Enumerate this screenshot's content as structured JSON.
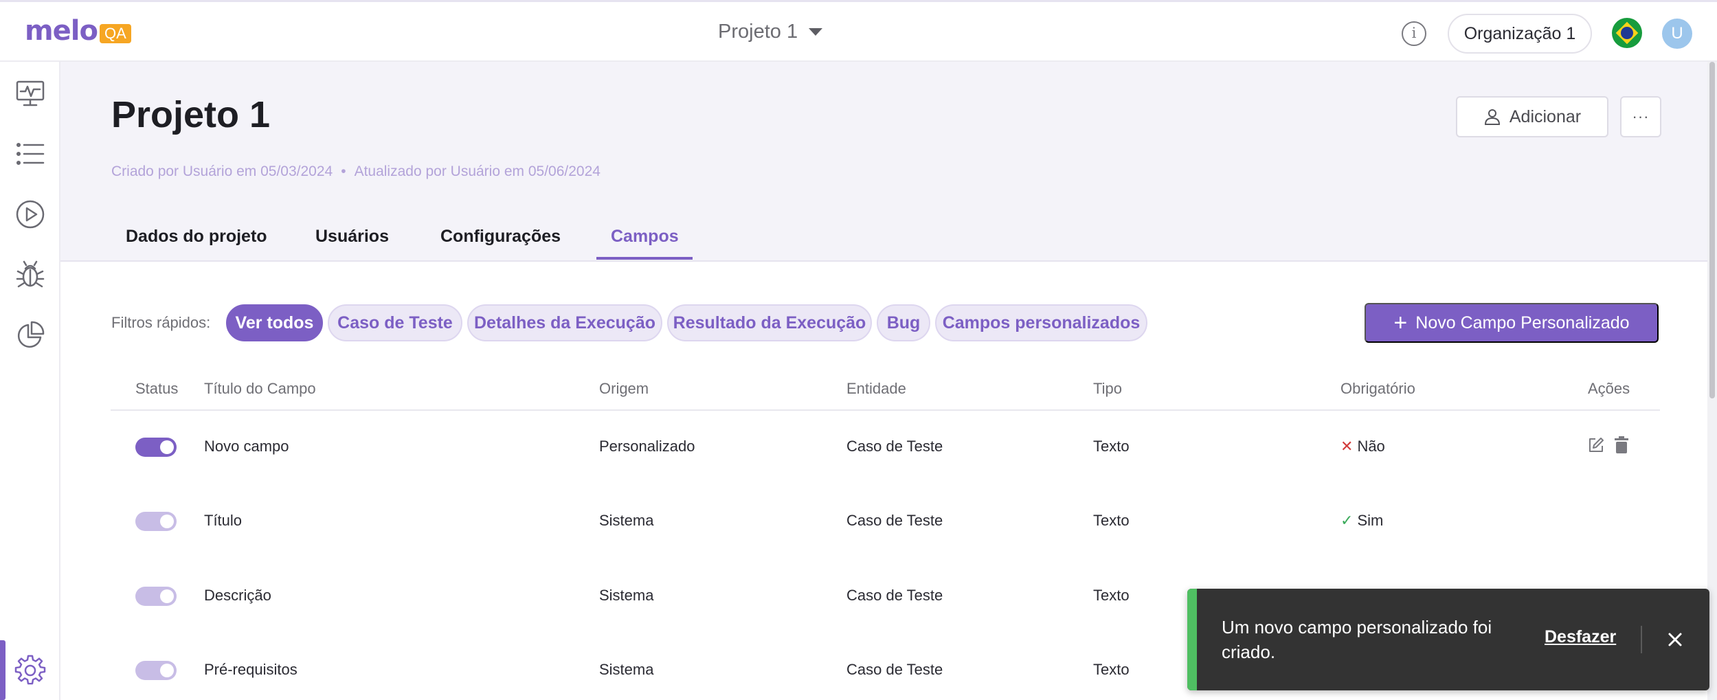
{
  "brand": {
    "name": "melo",
    "badge": "QA",
    "color": "#7c5fc4",
    "badge_color": "#f6a623"
  },
  "topbar": {
    "project_selector": "Projeto 1",
    "info_icon": "info-icon",
    "organization": "Organização 1",
    "language_icon": "brazil-flag-icon",
    "avatar_initial": "U"
  },
  "sidebar": {
    "items": [
      {
        "name": "dashboard",
        "icon": "monitor-pulse-icon"
      },
      {
        "name": "test-cases",
        "icon": "list-icon"
      },
      {
        "name": "executions",
        "icon": "play-circle-icon"
      },
      {
        "name": "bugs",
        "icon": "bug-icon"
      },
      {
        "name": "reports",
        "icon": "pie-chart-icon"
      },
      {
        "name": "settings",
        "icon": "gear-icon",
        "active": true
      }
    ]
  },
  "page": {
    "title": "Projeto 1",
    "created": "Criado por Usuário em 05/03/2024",
    "separator": "•",
    "updated": "Atualizado por Usuário em 05/06/2024",
    "add_label": "Adicionar",
    "more_label": "···",
    "tabs": [
      {
        "label": "Dados do projeto",
        "active": false
      },
      {
        "label": "Usuários",
        "active": false
      },
      {
        "label": "Configurações",
        "active": false
      },
      {
        "label": "Campos",
        "active": true
      }
    ]
  },
  "filters": {
    "label": "Filtros rápidos:",
    "chips": [
      {
        "label": "Ver todos",
        "active": true
      },
      {
        "label": "Caso de Teste",
        "active": false
      },
      {
        "label": "Detalhes da Execução",
        "active": false
      },
      {
        "label": "Resultado da Execução",
        "active": false
      },
      {
        "label": "Bug",
        "active": false
      },
      {
        "label": "Campos personalizados",
        "active": false
      }
    ],
    "new_field_label": "Novo Campo Personalizado"
  },
  "table": {
    "headers": {
      "status": "Status",
      "title": "Título do Campo",
      "origin": "Origem",
      "entity": "Entidade",
      "type": "Tipo",
      "required": "Obrigatório",
      "actions": "Ações"
    },
    "rows": [
      {
        "enabled": true,
        "editable": true,
        "title": "Novo campo",
        "origin": "Personalizado",
        "entity": "Caso de Teste",
        "type": "Texto",
        "required_mark": "✕",
        "required": "Não"
      },
      {
        "enabled": true,
        "editable": false,
        "title": "Título",
        "origin": "Sistema",
        "entity": "Caso de Teste",
        "type": "Texto",
        "required_mark": "✓",
        "required": "Sim"
      },
      {
        "enabled": true,
        "editable": false,
        "title": "Descrição",
        "origin": "Sistema",
        "entity": "Caso de Teste",
        "type": "Texto"
      },
      {
        "enabled": true,
        "editable": false,
        "title": "Pré-requisitos",
        "origin": "Sistema",
        "entity": "Caso de Teste",
        "type": "Texto"
      }
    ]
  },
  "toast": {
    "message": "Um novo campo personalizado foi criado.",
    "undo_label": "Desfazer",
    "accent_color": "#4fbf62"
  }
}
